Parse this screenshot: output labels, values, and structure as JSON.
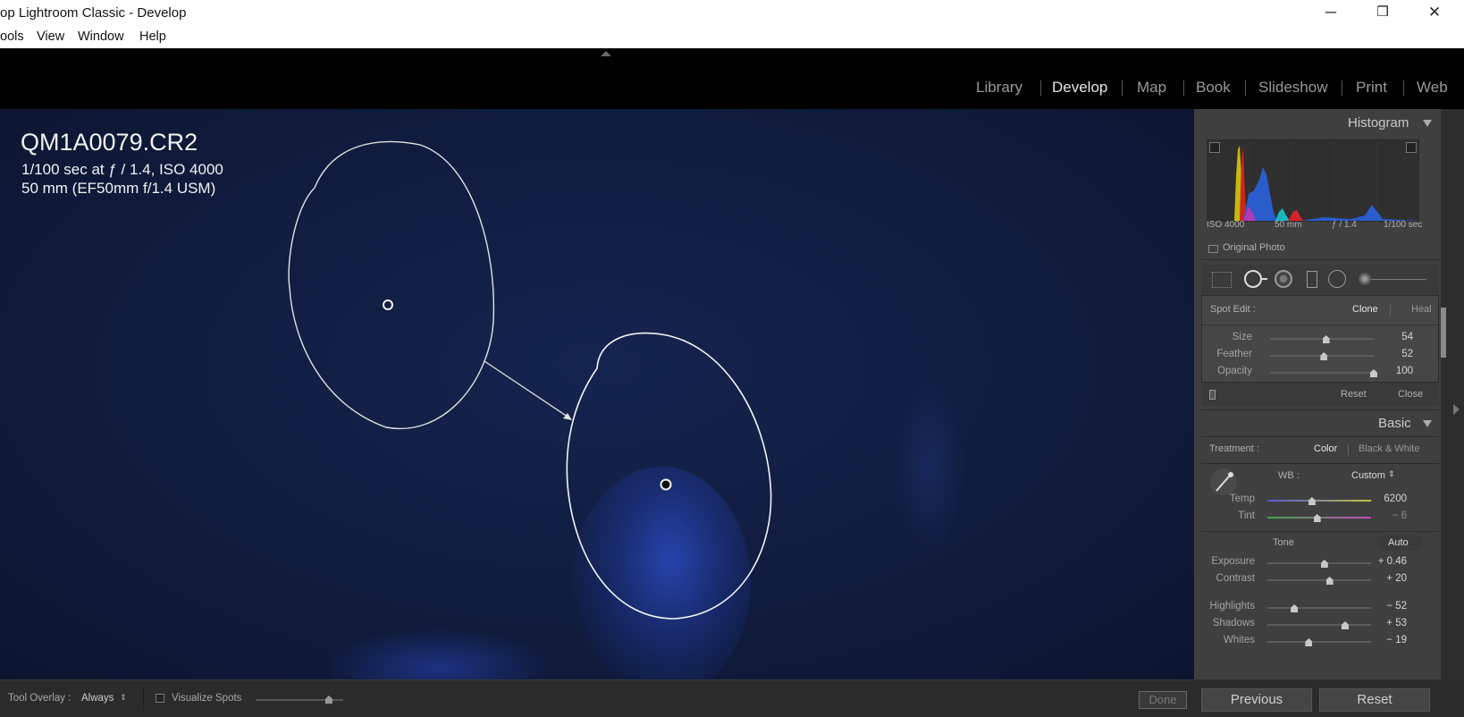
{
  "window": {
    "title": "op Lightroom Classic - Develop",
    "minimize_glyph": "─",
    "restore_glyph": "❐",
    "close_glyph": "✕"
  },
  "menu": [
    "ools",
    "View",
    "Window",
    "Help"
  ],
  "modules": {
    "items": [
      "Library",
      "Develop",
      "Map",
      "Book",
      "Slideshow",
      "Print",
      "Web"
    ],
    "active": "Develop"
  },
  "image_info": {
    "filename": "QM1A0079.CR2",
    "exposure_line": "1/100 sec at ƒ / 1.4, ISO 4000",
    "lens_line": "50 mm (EF50mm f/1.4 USM)"
  },
  "toolbar": {
    "tool_overlay_label": "Tool Overlay :",
    "tool_overlay_value": "Always",
    "visualize_spots_label": "Visualize Spots",
    "done_label": "Done"
  },
  "histogram": {
    "title": "Histogram",
    "iso": "ISO 4000",
    "focal": "50 mm",
    "aperture": "ƒ / 1.4",
    "shutter": "1/100 sec",
    "original_photo_label": "Original Photo"
  },
  "spot_edit": {
    "label": "Spot Edit :",
    "clone_label": "Clone",
    "heal_label": "Heal",
    "active_mode": "Clone",
    "sliders": [
      {
        "name": "Size",
        "value": "54",
        "level": 0.54
      },
      {
        "name": "Feather",
        "value": "52",
        "level": 0.52
      },
      {
        "name": "Opacity",
        "value": "100",
        "level": 1.0
      }
    ],
    "reset_label": "Reset",
    "close_label": "Close"
  },
  "basic": {
    "title": "Basic",
    "treatment_label": "Treatment :",
    "color_label": "Color",
    "bw_label": "Black & White",
    "wb_label": "WB :",
    "wb_value": "Custom",
    "temp": {
      "name": "Temp",
      "value": "6200",
      "level": 0.43
    },
    "tint": {
      "name": "Tint",
      "value": "− 6",
      "level": 0.48
    },
    "tone_label": "Tone",
    "auto_label": "Auto",
    "tone_sliders": [
      {
        "name": "Exposure",
        "value": "+ 0.46",
        "level": 0.55
      },
      {
        "name": "Contrast",
        "value": "+ 20",
        "level": 0.6
      },
      {
        "name": "Highlights",
        "value": "− 52",
        "level": 0.26
      },
      {
        "name": "Shadows",
        "value": "+ 53",
        "level": 0.75
      },
      {
        "name": "Whites",
        "value": "− 19",
        "level": 0.4
      }
    ]
  },
  "footer": {
    "previous_label": "Previous",
    "reset_label": "Reset"
  },
  "colors": {
    "background": "#000000",
    "panel": "#3f3f3f",
    "photo_blue": "#14234c",
    "spot_outline": "#e8e8e8"
  }
}
